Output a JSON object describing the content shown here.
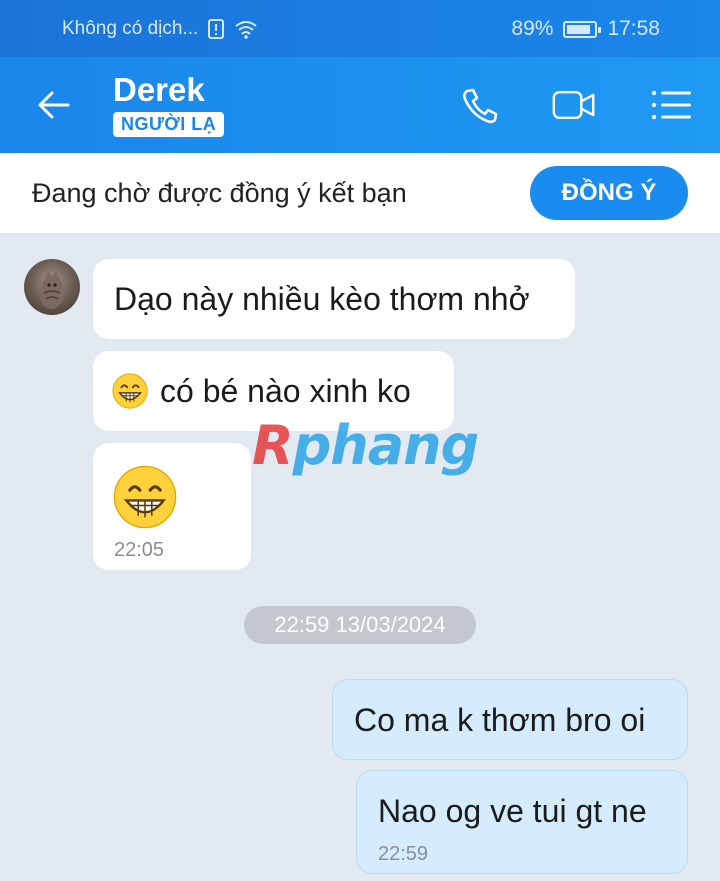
{
  "status_bar": {
    "carrier": "Không có dịch...",
    "battery": "89%",
    "battery_level": 0.89,
    "time": "17:58"
  },
  "header": {
    "contact_name": "Derek",
    "badge": "NGƯỜI LẠ",
    "icons": [
      "back-arrow-icon",
      "phone-icon",
      "video-call-icon",
      "menu-icon"
    ]
  },
  "friend_request": {
    "text": "Đang chờ được đồng ý kết bạn",
    "accept_label": "ĐỒNG Ý"
  },
  "messages": [
    {
      "from": "them",
      "text": "Dạo này nhiều kèo thơm nhở"
    },
    {
      "from": "them",
      "emoji": "grinning-face-icon",
      "text": "có bé nào xinh ko"
    },
    {
      "from": "them",
      "emoji": "grinning-face-icon",
      "time": "22:05"
    },
    {
      "from": "me",
      "text": "Co ma k thơm bro oi"
    },
    {
      "from": "me",
      "text": "Nao og ve tui gt ne",
      "time": "22:59"
    }
  ],
  "date_divider": "22:59 13/03/2024",
  "watermark": {
    "first": "R",
    "rest": "phang"
  },
  "colors": {
    "header": "#1a86ea",
    "accept": "#1a8cf0",
    "chat_bg": "#e2e9f1",
    "my_bubble": "#d4ecfd"
  }
}
